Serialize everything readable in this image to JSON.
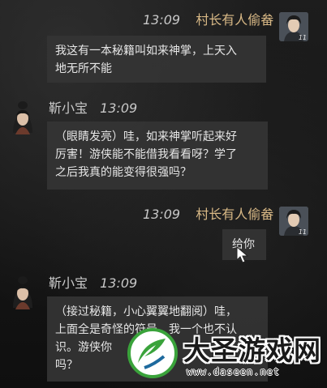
{
  "messages": [
    {
      "time": "13:09",
      "name": "村长有人偷畚",
      "level": "11",
      "text": "我这有一本秘籍叫如来神掌，上天入\n地无所不能"
    },
    {
      "time": "13:09",
      "name": "靳小宝",
      "text": "（眼睛发亮）哇，如来神掌听起来好\n厉害！游侠能不能借我看看呀？学了\n之后我真的能变得很强吗？"
    },
    {
      "time": "13:09",
      "name": "村长有人偷畚",
      "level": "11",
      "text": "给你"
    },
    {
      "time": "13:09",
      "name": "靳小宝",
      "text": "（接过秘籍，小心翼翼地翻阅）哇，\n上面全是奇怪的符号，我一个也不认\n识。游侠你\n吗？"
    }
  ],
  "watermark": {
    "title": "大圣游戏网",
    "url": "www.daseen.net"
  },
  "colors": {
    "player_name": "#d9b986",
    "npc_name": "#c8c8c8",
    "bubble": "#343434"
  }
}
